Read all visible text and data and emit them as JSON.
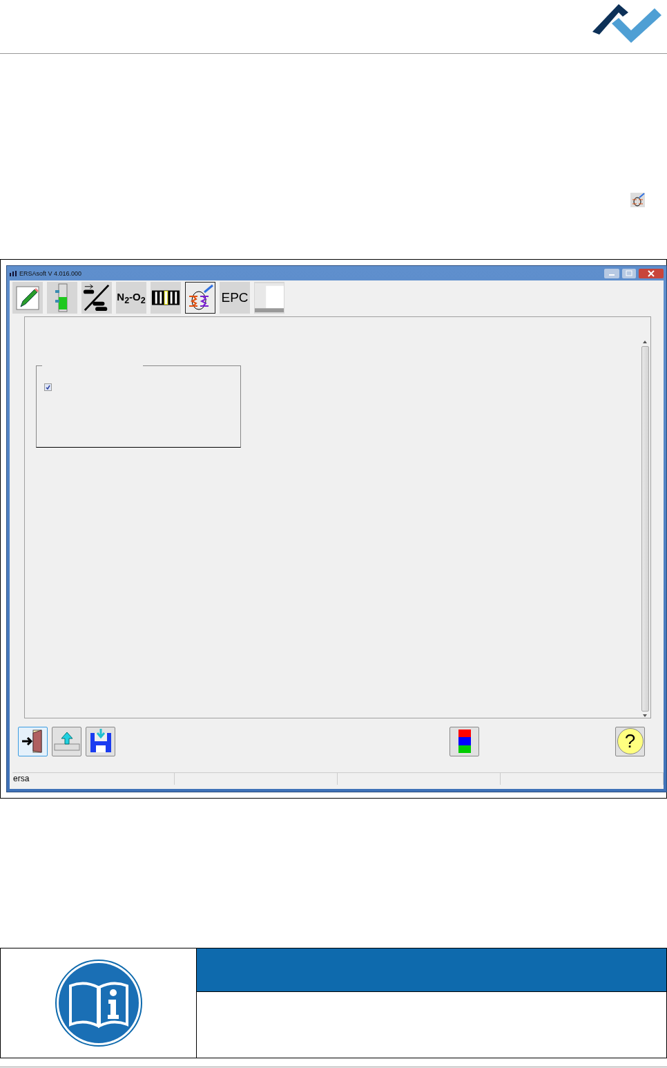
{
  "window": {
    "title": "ERSAsoft V 4.016.000"
  },
  "toolbar": [
    {
      "kind": "pencil",
      "selected": false
    },
    {
      "kind": "tower",
      "selected": false
    },
    {
      "kind": "conveyor",
      "selected": false
    },
    {
      "kind": "text",
      "label": "N$_{2}$-O$_{2}$",
      "selected": false
    },
    {
      "kind": "bars",
      "selected": false
    },
    {
      "kind": "heater",
      "selected": true
    },
    {
      "kind": "text",
      "label": "EPC",
      "selected": false
    },
    {
      "kind": "sheet",
      "selected": false
    }
  ],
  "options_group": {
    "checkbox": {
      "checked": true
    }
  },
  "bottom_buttons": [
    {
      "kind": "exit",
      "focused": true
    },
    {
      "kind": "upload",
      "focused": false
    },
    {
      "kind": "save",
      "focused": false
    },
    {
      "kind": "colors",
      "focused": false
    },
    {
      "kind": "help",
      "label": "?",
      "focused": false
    }
  ],
  "status_bar": [
    "ersa"
  ]
}
